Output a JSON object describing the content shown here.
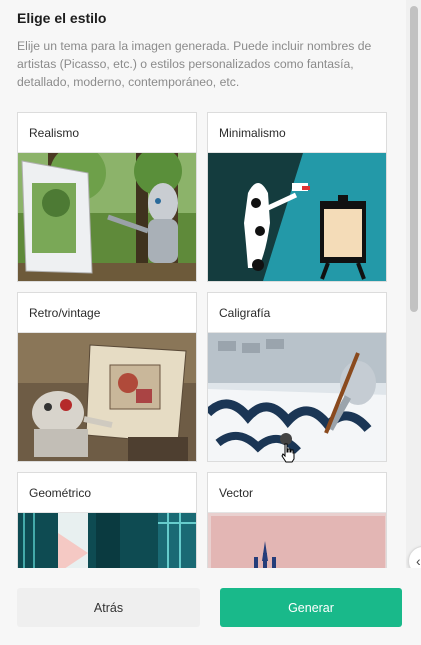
{
  "header": {
    "title": "Elige el estilo",
    "description": "Elije un tema para la imagen generada. Puede incluir nombres de artistas (Picasso, etc.) o estilos personalizados como fantasía, detallado, moderno, contemporáneo, etc."
  },
  "styles": [
    {
      "label": "Realismo"
    },
    {
      "label": "Minimalismo"
    },
    {
      "label": "Retro/vintage"
    },
    {
      "label": "Caligrafía"
    },
    {
      "label": "Geométrico"
    },
    {
      "label": "Vector"
    }
  ],
  "footer": {
    "back_label": "Atrás",
    "generate_label": "Generar"
  },
  "colors": {
    "accent": "#19b98a",
    "background": "#f7f7f7"
  },
  "icons": {
    "collapse": "chevron-left-icon",
    "cursor": "hand-pointer-icon"
  }
}
